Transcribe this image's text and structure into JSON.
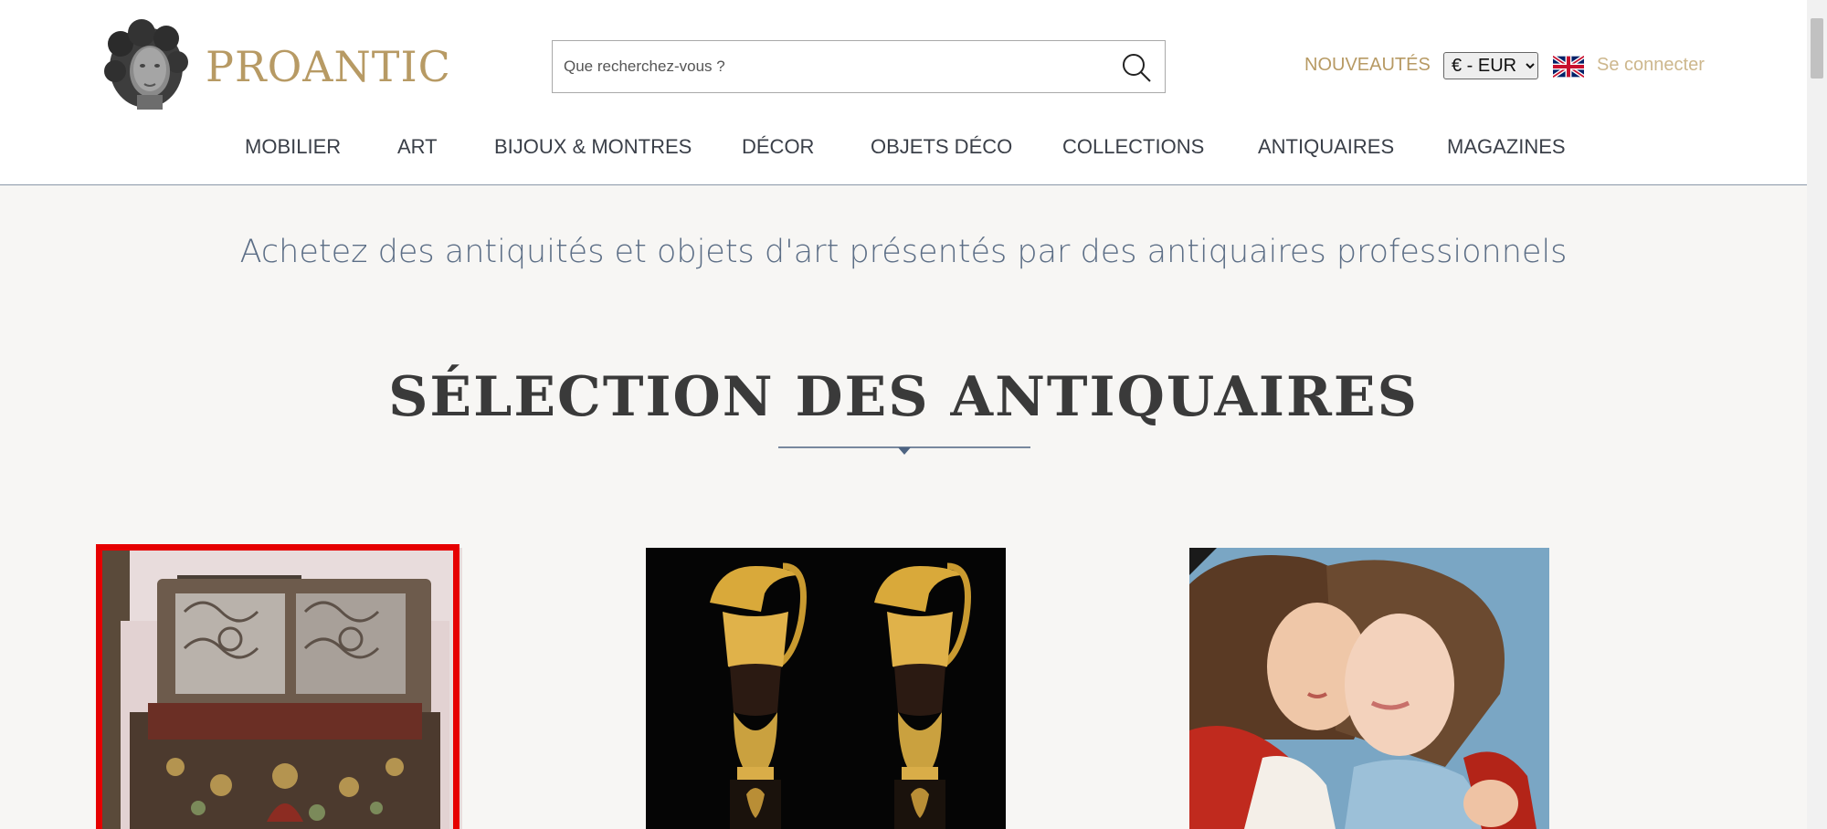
{
  "header": {
    "brand": "PROANTIC",
    "search": {
      "placeholder": "Que recherchez-vous ?",
      "value": ""
    },
    "new_items_label": "NOUVEAUTÉS",
    "currency": {
      "selected": "€ - EUR",
      "options": [
        "€ - EUR"
      ]
    },
    "language_icon": "uk-flag-icon",
    "login_label": "Se connecter"
  },
  "nav": {
    "items": [
      {
        "label": "MOBILIER"
      },
      {
        "label": "ART"
      },
      {
        "label": "BIJOUX & MONTRES"
      },
      {
        "label": "DÉCOR"
      },
      {
        "label": "OBJETS DÉCO"
      },
      {
        "label": "COLLECTIONS"
      },
      {
        "label": "ANTIQUAIRES"
      },
      {
        "label": "MAGAZINES"
      }
    ]
  },
  "main": {
    "tagline": "Achetez des antiquités et objets d'art présentés par des antiquaires professionnels",
    "section_title": "SÉLECTION DES ANTIQUAIRES",
    "cards": [
      {
        "image": "antique-painted-chest"
      },
      {
        "image": "gilt-bronze-ewer-pair"
      },
      {
        "image": "pastel-portrait-couple"
      }
    ]
  },
  "colors": {
    "brand_gold": "#b79a64",
    "tagline_blue": "#5c6e86",
    "highlight_red": "#e60000",
    "page_bg": "#f7f6f4"
  }
}
